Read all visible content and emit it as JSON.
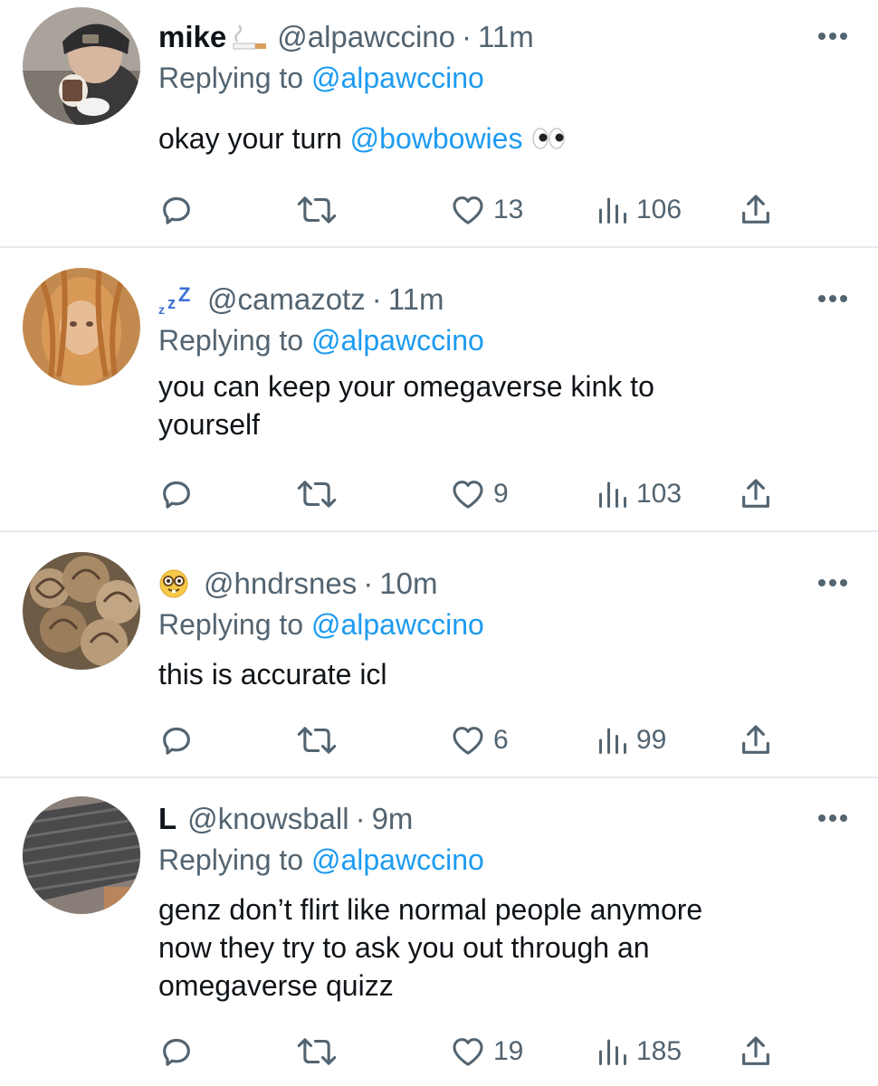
{
  "colors": {
    "accent": "#1d9bf0",
    "secondary": "#536471",
    "text": "#0f1419",
    "divider": "#e7e9eb"
  },
  "replies": [
    {
      "display_name": "mike",
      "name_emoji": "cigarette-emoji",
      "handle": "@alpawccino",
      "dot": "·",
      "time": "11m",
      "replying_prefix": "Replying to",
      "replying_to": "@alpawccino",
      "text_before": "okay your turn ",
      "mention": "@bowbowies",
      "text_after": "",
      "text_emoji": "eyes-emoji",
      "likes": "13",
      "views": "106"
    },
    {
      "display_name": "",
      "name_emoji": "zzz-emoji",
      "handle": "@camazotz",
      "dot": "·",
      "time": "11m",
      "replying_prefix": "Replying to",
      "replying_to": "@alpawccino",
      "text_line1": "you can keep your omegaverse kink to",
      "text_line2": "yourself",
      "likes": "9",
      "views": "103"
    },
    {
      "display_name": "",
      "name_emoji": "nerd-face-emoji",
      "handle": "@hndrsnes",
      "dot": "·",
      "time": "10m",
      "replying_prefix": "Replying to",
      "replying_to": "@alpawccino",
      "text_line1": "this is accurate icl",
      "likes": "6",
      "views": "99"
    },
    {
      "display_name": "L",
      "handle": "@knowsball",
      "dot": "·",
      "time": "9m",
      "replying_prefix": "Replying to",
      "replying_to": "@alpawccino",
      "text_line1": "genz don’t flirt like normal people anymore",
      "text_line2": "now they try to ask you out through an",
      "text_line3": "omegaverse quizz",
      "likes": "19",
      "views": "185"
    }
  ]
}
